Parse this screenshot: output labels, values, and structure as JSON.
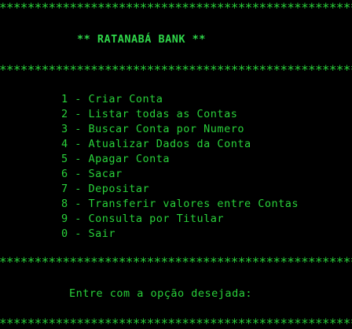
{
  "theme": {
    "background": "#000000",
    "foreground": "#29d13a"
  },
  "separator": "****************************************************",
  "title": "** RATANABÁ BANK **",
  "menu": [
    "1 - Criar Conta",
    "2 - Listar todas as Contas",
    "3 - Buscar Conta por Numero",
    "4 - Atualizar Dados da Conta",
    "5 - Apagar Conta",
    "6 - Sacar",
    "7 - Depositar",
    "8 - Transferir valores entre Contas",
    "9 - Consulta por Titular",
    "0 - Sair"
  ],
  "prompt": "Entre com a opção desejada:"
}
